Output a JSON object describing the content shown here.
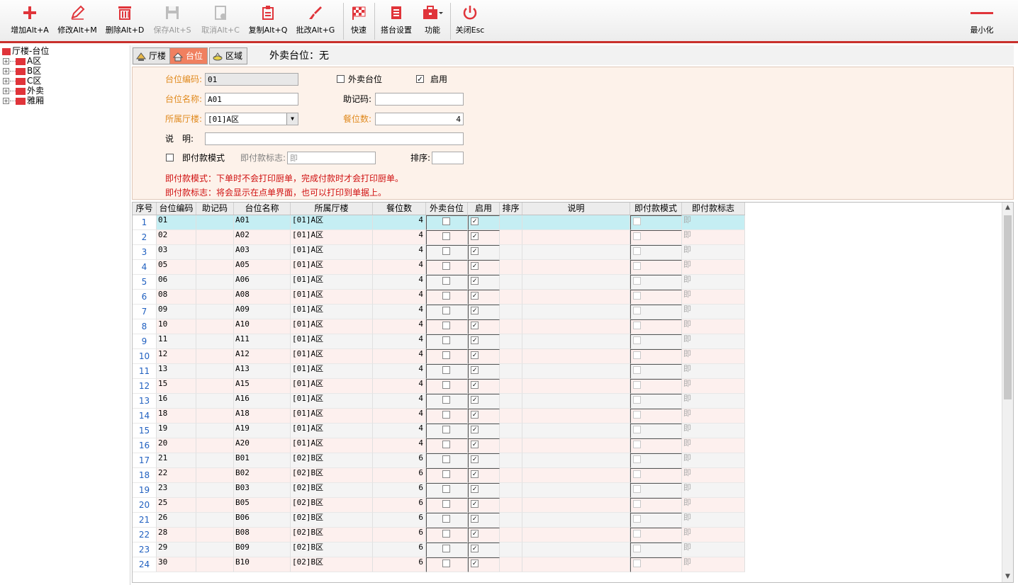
{
  "toolbar": {
    "add": "增加Alt+A",
    "edit": "修改Alt+M",
    "delete": "删除Alt+D",
    "save": "保存Alt+S",
    "cancel": "取消Alt+C",
    "copy": "复制Alt+Q",
    "batch": "批改Alt+G",
    "quick": "快速",
    "table_setting": "搭台设置",
    "function": "功能",
    "close": "关闭Esc",
    "minimize": "最小化"
  },
  "tree": {
    "root": "厅楼-台位",
    "items": [
      "A区",
      "B区",
      "C区",
      "外卖",
      "雅厢"
    ]
  },
  "tabs": [
    "厅楼",
    "台位",
    "区域"
  ],
  "takeout": "外卖台位：无",
  "form": {
    "code_label": "台位编码:",
    "code_value": "01",
    "name_label": "台位名称:",
    "name_value": "A01",
    "hall_label": "所属厅楼:",
    "hall_value": "[01]A区",
    "takeout_label": "外卖台位",
    "enable_label": "启用",
    "memo_code_label": "助记码:",
    "memo_code_value": "",
    "seats_label": "餐位数:",
    "seats_value": "4",
    "desc_label": "说　明:",
    "desc_value": "",
    "instant_pay_label": "即付款模式",
    "instant_flag_label": "即付款标志:",
    "instant_flag_value": "即",
    "sort_label": "排序:",
    "sort_value": "",
    "note1": "即付款模式：下单时不会打印厨单，完成付款时才会打印厨单。",
    "note2": "即付款标志：将会显示在点单界面，也可以打印到单据上。"
  },
  "grid": {
    "headers": [
      "序号",
      "台位编码",
      "助记码",
      "台位名称",
      "所属厅楼",
      "餐位数",
      "外卖台位",
      "启用",
      "排序",
      "说明",
      "即付款模式",
      "即付款标志"
    ],
    "rows": [
      {
        "seq": "1",
        "code": "01",
        "name": "A01",
        "hall": "[01]A区",
        "seats": "4",
        "flag": "即"
      },
      {
        "seq": "2",
        "code": "02",
        "name": "A02",
        "hall": "[01]A区",
        "seats": "4",
        "flag": "即"
      },
      {
        "seq": "3",
        "code": "03",
        "name": "A03",
        "hall": "[01]A区",
        "seats": "4",
        "flag": "即"
      },
      {
        "seq": "4",
        "code": "05",
        "name": "A05",
        "hall": "[01]A区",
        "seats": "4",
        "flag": "即"
      },
      {
        "seq": "5",
        "code": "06",
        "name": "A06",
        "hall": "[01]A区",
        "seats": "4",
        "flag": "即"
      },
      {
        "seq": "6",
        "code": "08",
        "name": "A08",
        "hall": "[01]A区",
        "seats": "4",
        "flag": "即"
      },
      {
        "seq": "7",
        "code": "09",
        "name": "A09",
        "hall": "[01]A区",
        "seats": "4",
        "flag": "即"
      },
      {
        "seq": "8",
        "code": "10",
        "name": "A10",
        "hall": "[01]A区",
        "seats": "4",
        "flag": "即"
      },
      {
        "seq": "9",
        "code": "11",
        "name": "A11",
        "hall": "[01]A区",
        "seats": "4",
        "flag": "即"
      },
      {
        "seq": "10",
        "code": "12",
        "name": "A12",
        "hall": "[01]A区",
        "seats": "4",
        "flag": "即"
      },
      {
        "seq": "11",
        "code": "13",
        "name": "A13",
        "hall": "[01]A区",
        "seats": "4",
        "flag": "即"
      },
      {
        "seq": "12",
        "code": "15",
        "name": "A15",
        "hall": "[01]A区",
        "seats": "4",
        "flag": "即"
      },
      {
        "seq": "13",
        "code": "16",
        "name": "A16",
        "hall": "[01]A区",
        "seats": "4",
        "flag": "即"
      },
      {
        "seq": "14",
        "code": "18",
        "name": "A18",
        "hall": "[01]A区",
        "seats": "4",
        "flag": "即"
      },
      {
        "seq": "15",
        "code": "19",
        "name": "A19",
        "hall": "[01]A区",
        "seats": "4",
        "flag": "即"
      },
      {
        "seq": "16",
        "code": "20",
        "name": "A20",
        "hall": "[01]A区",
        "seats": "4",
        "flag": "即"
      },
      {
        "seq": "17",
        "code": "21",
        "name": "B01",
        "hall": "[02]B区",
        "seats": "6",
        "flag": "即"
      },
      {
        "seq": "18",
        "code": "22",
        "name": "B02",
        "hall": "[02]B区",
        "seats": "6",
        "flag": "即"
      },
      {
        "seq": "19",
        "code": "23",
        "name": "B03",
        "hall": "[02]B区",
        "seats": "6",
        "flag": "即"
      },
      {
        "seq": "20",
        "code": "25",
        "name": "B05",
        "hall": "[02]B区",
        "seats": "6",
        "flag": "即"
      },
      {
        "seq": "21",
        "code": "26",
        "name": "B06",
        "hall": "[02]B区",
        "seats": "6",
        "flag": "即"
      },
      {
        "seq": "22",
        "code": "28",
        "name": "B08",
        "hall": "[02]B区",
        "seats": "6",
        "flag": "即"
      },
      {
        "seq": "23",
        "code": "29",
        "name": "B09",
        "hall": "[02]B区",
        "seats": "6",
        "flag": "即"
      },
      {
        "seq": "24",
        "code": "30",
        "name": "B10",
        "hall": "[02]B区",
        "seats": "6",
        "flag": "即"
      }
    ]
  },
  "colors": {
    "accent": "#e0343a",
    "selected_row": "#c5eef3",
    "row_pink": "#fdf0ee",
    "row_gray": "#f4f4f4",
    "required_label": "#e08a1e",
    "note_red": "#d01010"
  },
  "icons": [
    "plus-icon",
    "pencil-icon",
    "trash-icon",
    "save-icon",
    "cancel-icon",
    "copy-icon",
    "brush-icon",
    "checkered-flag-icon",
    "document-icon",
    "toolbox-icon",
    "power-icon",
    "minimize-icon"
  ]
}
